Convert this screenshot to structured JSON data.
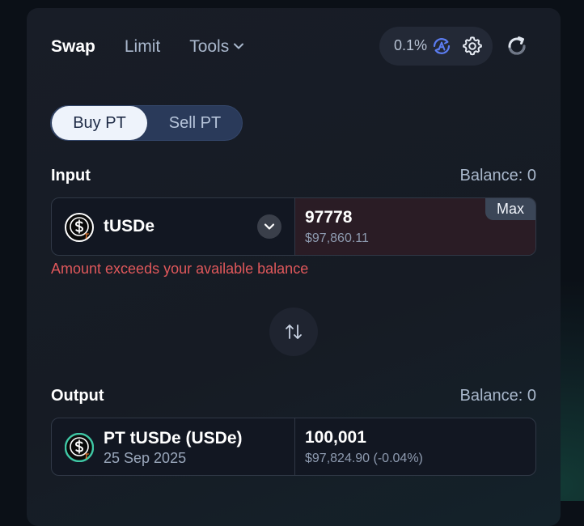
{
  "nav": {
    "tabs": [
      {
        "label": "Swap"
      },
      {
        "label": "Limit"
      },
      {
        "label": "Tools"
      }
    ]
  },
  "settings": {
    "slippage": "0.1%",
    "icons": [
      "auto-slippage-icon",
      "gear-icon",
      "refresh-icon"
    ]
  },
  "mode_toggle": {
    "buy_label": "Buy PT",
    "sell_label": "Sell PT",
    "selected": "Buy PT"
  },
  "input": {
    "label": "Input",
    "balance": "Balance: 0",
    "token": "tUSDe",
    "amount": "97778",
    "usd_value": "$97,860.11",
    "max_label": "Max",
    "error": "Amount exceeds your available balance"
  },
  "output": {
    "label": "Output",
    "balance": "Balance: 0",
    "token": "PT tUSDe (USDe)",
    "maturity": "25 Sep 2025",
    "amount": "100,001",
    "usd_value": "$97,824.90 (-0.04%)"
  },
  "colors": {
    "error": "#e0585b",
    "accent": "#5b7cf0",
    "input_highlight": "#2a1c25"
  }
}
